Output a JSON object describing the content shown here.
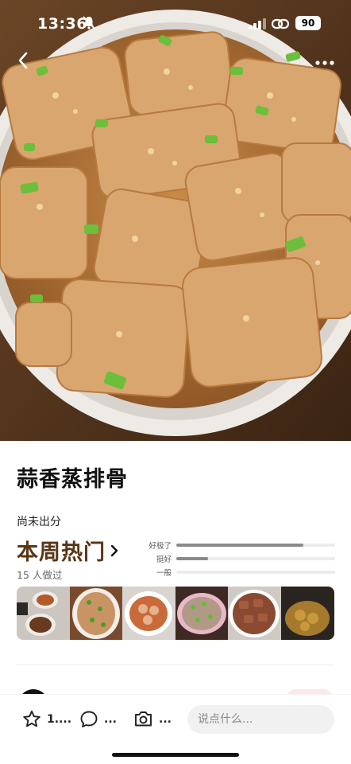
{
  "status_bar": {
    "time": "13:36",
    "battery": "90"
  },
  "recipe": {
    "title": "蒜香蒸排骨",
    "rating_status": "尚未出分",
    "hot_label": "本周热门",
    "made_count": "15 人做过"
  },
  "ratings": [
    {
      "label": "好极了",
      "level": 0.8
    },
    {
      "label": "挺好",
      "level": 0.2
    },
    {
      "label": "一般",
      "level": 0.0
    }
  ],
  "actions": {
    "star_count": "1....",
    "comment_count": "...",
    "photo_count": "...",
    "say_placeholder": "说点什么..."
  },
  "icons": [
    "back-icon",
    "more-icon",
    "silent-bell-icon",
    "signal-icon",
    "link-icon",
    "battery-icon",
    "chevron-right-icon",
    "star-icon",
    "comment-icon",
    "camera-icon"
  ]
}
